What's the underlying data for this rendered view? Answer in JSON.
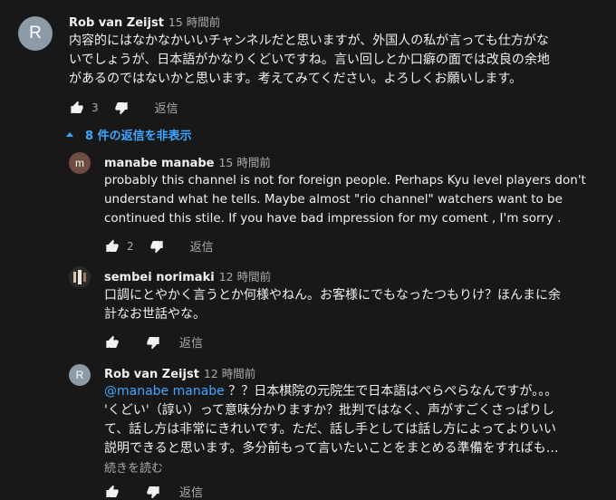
{
  "comment": {
    "avatar_letter": "R",
    "author": "Rob van Zeijst",
    "time": "15 時間前",
    "lines": [
      "内容的にはなかなかいいチャンネルだと思いますが、外国人の私が言っても仕方がな",
      "いでしょうが、日本語がかなりくどいですね。言い回しとか口癖の面では改良の余地",
      "があるのではないかと思います。考えてみてください。よろしくお願いします。"
    ],
    "likes": "3",
    "reply_label": "返信"
  },
  "replies_toggle": "8 件の返信を非表示",
  "replies": [
    {
      "avatar_letter": "m",
      "author": "manabe manabe",
      "time": "15 時間前",
      "lines": [
        "probably this channel is not for foreign people. Perhaps  Kyu level players don't",
        "understand what he tells. Maybe almost  \"rio channel\" watchers want to be",
        "continued  this stile. If you have bad impression for my coment , I'm sorry ."
      ],
      "likes": "2",
      "reply_label": "返信"
    },
    {
      "author": "sembei norimaki",
      "time": "12 時間前",
      "lines": [
        "口調にとやかく言うとか何様やねん。お客様にでもなったつもりけ？ほんまに余",
        "計なお世話やな。"
      ],
      "likes": "",
      "reply_label": "返信"
    },
    {
      "avatar_letter": "R",
      "author": "Rob van Zeijst",
      "time": "12 時間前",
      "mention": "@manabe manabe",
      "first_line_rest": " ？？日本棋院の元院生で日本語はぺらぺらなんですが。。。",
      "lines": [
        "'くどい'（諄い）って意味分かりますか？批判ではなく、声がすごくさっぱりし",
        "て、話し方は非常にきれいです。ただ、話し手としては話し方によってよりいい",
        "説明できると思います。多分前もって言いたいことをまとめる準備をすればも…"
      ],
      "read_more": "続きを読む",
      "reply_label": "返信"
    }
  ],
  "colors": {
    "background": "#181818",
    "link": "#3ea6ff",
    "secondary_text": "#aaaaaa",
    "avatar_r": "#8c9ba8",
    "avatar_m": "#6d4c41"
  }
}
